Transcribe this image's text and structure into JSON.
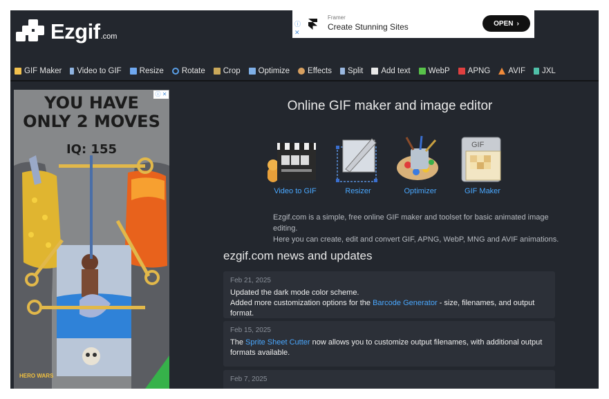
{
  "header": {
    "logo_text": "Ezgif",
    "logo_tld": ".com"
  },
  "top_ad": {
    "info_mark": "ⓘ",
    "close_mark": "✕",
    "brand": "Framer",
    "headline": "Create Stunning Sites",
    "cta": "OPEN",
    "cta_arrow": "›"
  },
  "nav": {
    "items": [
      {
        "label": "GIF Maker",
        "icon": "gif-maker-icon",
        "color": "#f2c14e"
      },
      {
        "label": "Video to GIF",
        "icon": "video-icon",
        "color": "#8fb3e0"
      },
      {
        "label": "Resize",
        "icon": "resize-icon",
        "color": "#6fa8f0"
      },
      {
        "label": "Rotate",
        "icon": "rotate-icon",
        "color": "#5aa0e8"
      },
      {
        "label": "Crop",
        "icon": "crop-icon",
        "color": "#c9a85a"
      },
      {
        "label": "Optimize",
        "icon": "optimize-icon",
        "color": "#7fb0e8"
      },
      {
        "label": "Effects",
        "icon": "effects-icon",
        "color": "#d8a060"
      },
      {
        "label": "Split",
        "icon": "split-icon",
        "color": "#9ab8e0"
      },
      {
        "label": "Add text",
        "icon": "add-text-icon",
        "color": "#e8e8e8"
      },
      {
        "label": "WebP",
        "icon": "webp-icon",
        "color": "#58c24a"
      },
      {
        "label": "APNG",
        "icon": "apng-icon",
        "color": "#e04040"
      },
      {
        "label": "AVIF",
        "icon": "avif-icon",
        "color": "#f08a3a"
      },
      {
        "label": "JXL",
        "icon": "jxl-icon",
        "color": "#4fc0a8"
      }
    ]
  },
  "side_ad": {
    "headline_1": "YOU HAVE",
    "headline_2": "ONLY 2 MOVES",
    "score": "IQ: 155",
    "brand": "HERO WARS",
    "adchoice": "ⓘ ✕"
  },
  "main": {
    "title": "Online GIF maker and image editor",
    "tools": [
      {
        "label": "Video to GIF",
        "icon": "clapperboard-icon"
      },
      {
        "label": "Resizer",
        "icon": "resizer-icon"
      },
      {
        "label": "Optimizer",
        "icon": "paint-palette-icon"
      },
      {
        "label": "GIF Maker",
        "icon": "gif-stack-icon"
      }
    ],
    "intro_1": "Ezgif.com is a simple, free online GIF maker and toolset for basic animated image editing.",
    "intro_2": "Here you can create, edit and convert GIF, APNG, WebP, MNG and AVIF animations."
  },
  "news": {
    "title": "ezgif.com news and updates",
    "items": [
      {
        "date": "Feb 21, 2025",
        "line1": "Updated the dark mode color scheme.",
        "line2_pre": "Added more customization options for the ",
        "line2_link": "Barcode Generator",
        "line2_post": " - size, filenames, and output format."
      },
      {
        "date": "Feb 15, 2025",
        "line1_pre": "The ",
        "line1_link": "Sprite Sheet Cutter",
        "line1_post": " now allows you to customize output filenames, with additional output",
        "line2": "formats available."
      },
      {
        "date": "Feb 7, 2025"
      }
    ]
  },
  "colors": {
    "background": "#23272e",
    "link": "#4aa8ff",
    "card": "#2c3038"
  }
}
